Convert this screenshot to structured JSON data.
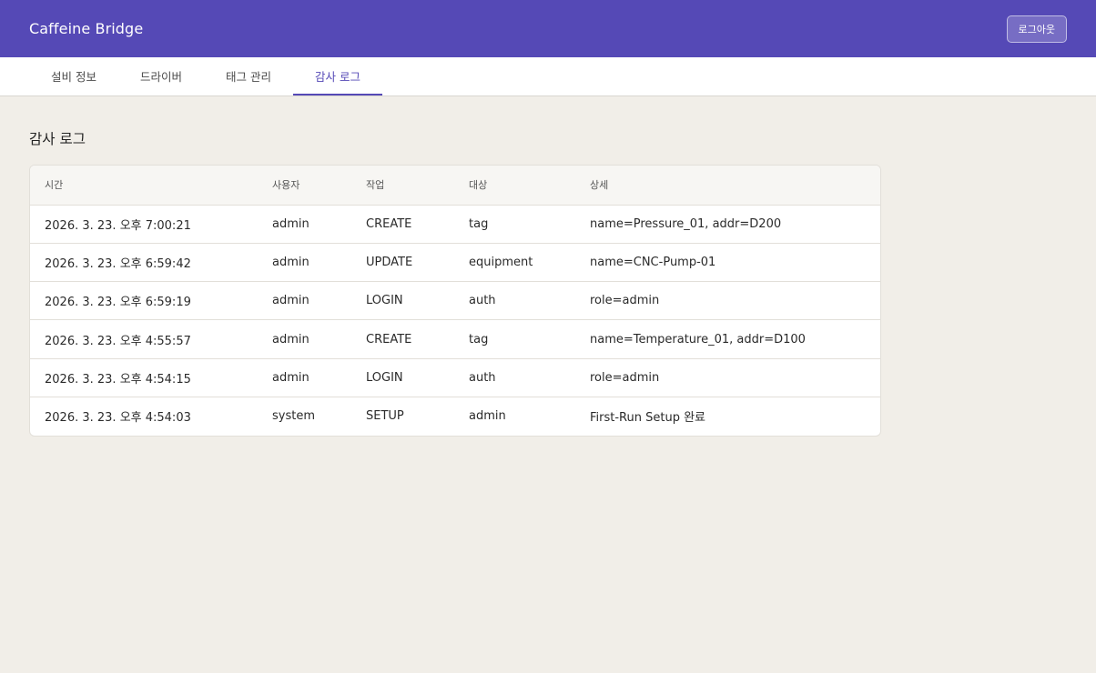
{
  "header": {
    "app_title": "Caffeine Bridge",
    "logout_label": "로그아웃",
    "accent_color": "#5549b6"
  },
  "tabs": [
    {
      "label": "설비 정보",
      "active": false
    },
    {
      "label": "드라이버",
      "active": false
    },
    {
      "label": "태그 관리",
      "active": false
    },
    {
      "label": "감사 로그",
      "active": true
    }
  ],
  "main": {
    "title": "감사 로그",
    "table": {
      "columns": [
        "시간",
        "사용자",
        "작업",
        "대상",
        "상세"
      ],
      "rows": [
        [
          "2026. 3. 23. 오후 7:00:21",
          "admin",
          "CREATE",
          "tag",
          "name=Pressure_01, addr=D200"
        ],
        [
          "2026. 3. 23. 오후 6:59:42",
          "admin",
          "UPDATE",
          "equipment",
          "name=CNC-Pump-01"
        ],
        [
          "2026. 3. 23. 오후 6:59:19",
          "admin",
          "LOGIN",
          "auth",
          "role=admin"
        ],
        [
          "2026. 3. 23. 오후 4:55:57",
          "admin",
          "CREATE",
          "tag",
          "name=Temperature_01, addr=D100"
        ],
        [
          "2026. 3. 23. 오후 4:54:15",
          "admin",
          "LOGIN",
          "auth",
          "role=admin"
        ],
        [
          "2026. 3. 23. 오후 4:54:03",
          "system",
          "SETUP",
          "admin",
          "First-Run Setup 완료"
        ]
      ]
    }
  }
}
